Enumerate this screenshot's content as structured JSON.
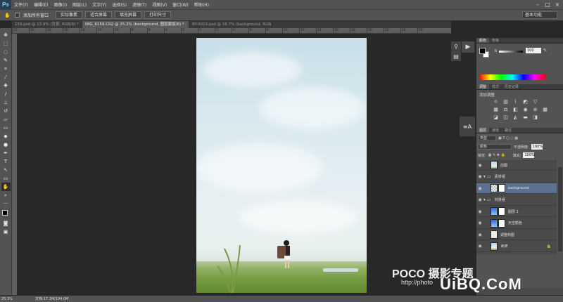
{
  "app": {
    "logo": "Ps",
    "menus": [
      "文件(F)",
      "编辑(E)",
      "图像(I)",
      "图层(L)",
      "文字(Y)",
      "选择(S)",
      "滤镜(T)",
      "视图(V)",
      "窗口(W)",
      "帮助(H)"
    ]
  },
  "options": {
    "checkbox_label": "添加所有窗口",
    "buttons": [
      "实际像素",
      "适合屏幕",
      "填充屏幕",
      "打印尺寸"
    ],
    "workspace": "基本功能"
  },
  "tabs": [
    {
      "label": "159.psd @ 13.9% (背景, RGB/8) *",
      "active": false
    },
    {
      "label": "IMG_6159.CR2 @ 25.3% (background, 图层蒙版/8) *",
      "active": true
    },
    {
      "label": "BY-0010.psd @ 16.7% (background, RGB/8)",
      "active": false
    }
  ],
  "ruler": [
    "22",
    "20",
    "18",
    "16",
    "14",
    "12",
    "10",
    "8",
    "6",
    "4",
    "2",
    "0",
    "2",
    "4",
    "6",
    "8",
    "10",
    "12",
    "14",
    "16",
    "18",
    "20",
    "22",
    "24",
    "26"
  ],
  "color_panel": {
    "tabs": [
      "颜色",
      "色板"
    ],
    "k_label": "K",
    "k_value": "100",
    "k_unit": "%"
  },
  "adjust_panel": {
    "tabs": [
      "调整",
      "样式",
      "历史记录"
    ],
    "title": "添加调整"
  },
  "layers_panel": {
    "tabs": [
      "图层",
      "通道",
      "路径"
    ],
    "filter": "类型",
    "blend_mode": "颜色",
    "opacity_label": "不透明度:",
    "opacity_value": "100%",
    "lock_label": "锁定:",
    "fill_label": "填充:",
    "fill_value": "100%",
    "layers": [
      {
        "name": "前图",
        "type": "sky",
        "selected": false,
        "folder": false
      },
      {
        "name": "素材组",
        "type": "folder",
        "selected": false,
        "folder": true
      },
      {
        "name": "background",
        "type": "check",
        "selected": true,
        "folder": false
      },
      {
        "name": "背景组",
        "type": "folder",
        "selected": false,
        "folder": true
      },
      {
        "name": "图层 1",
        "type": "blue",
        "selected": false,
        "folder": false
      },
      {
        "name": "天空颜色",
        "type": "blue",
        "selected": false,
        "folder": false
      },
      {
        "name": "调整构图",
        "type": "adj",
        "selected": false,
        "folder": false
      },
      {
        "name": "背景",
        "type": "sky",
        "selected": false,
        "folder": false
      }
    ]
  },
  "status": {
    "zoom": "25.3%",
    "doc": "文档:17.2M/194.0M"
  },
  "watermarks": {
    "poco": "POCO 摄影专题",
    "photo": "http://photo",
    "uibq": "UiBQ.CoM"
  }
}
